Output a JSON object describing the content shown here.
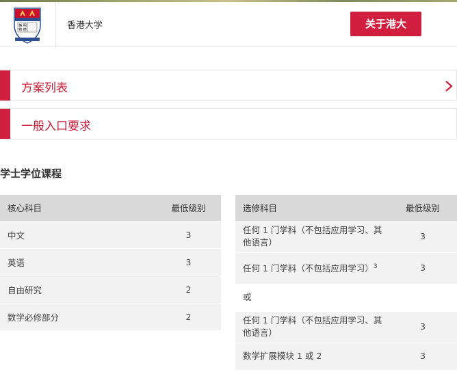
{
  "header": {
    "site_name": "香港大学",
    "about_button": "关于港大",
    "logo_lines": [
      "格 明",
      "物 德"
    ]
  },
  "accordions": [
    {
      "label": "方案列表",
      "expanded": false
    },
    {
      "label": "一般入口要求",
      "expanded": false
    }
  ],
  "section_title": "学士学位课程",
  "core_table": {
    "headers": [
      "核心科目",
      "最低级别"
    ],
    "rows": [
      {
        "subject": "中文",
        "level": "3"
      },
      {
        "subject": "英语",
        "level": "3"
      },
      {
        "subject": "自由研究",
        "level": "2"
      },
      {
        "subject": "数学必修部分",
        "level": "2"
      }
    ]
  },
  "elective_table": {
    "headers": [
      "选修科目",
      "最低级别"
    ],
    "rows": [
      {
        "subject": "任何 1 门学科（不包括应用学习、其他语言）",
        "level": "3"
      },
      {
        "subject": "任何 1 门学科（不包括应用学习）",
        "sup": "3",
        "level": "3"
      },
      {
        "or_label": "或"
      },
      {
        "subject": "任何 1 门学科（不包括应用学习、其他语言）",
        "level": "3"
      },
      {
        "subject": "数学扩展模块 1 或 2",
        "level": "3"
      }
    ]
  },
  "colors": {
    "accent": "#d11f3f",
    "header_bg": "#d9d9d9",
    "row_bg": "#f2f2f2"
  }
}
